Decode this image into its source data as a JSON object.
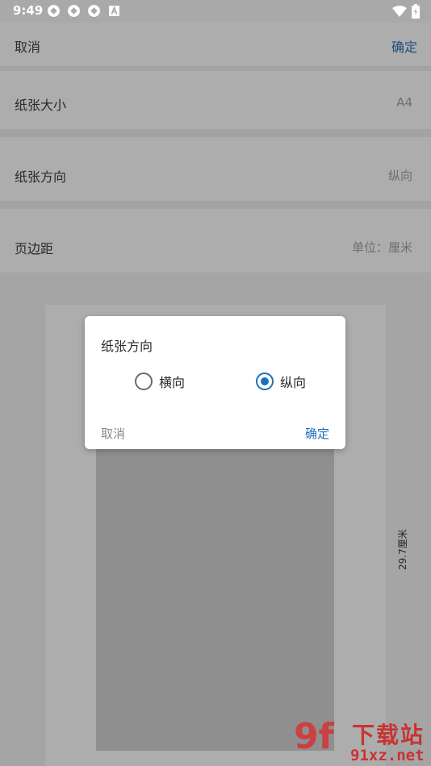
{
  "status_bar": {
    "time": "9:49",
    "icons": [
      "sync-icon",
      "sync-icon",
      "sync-icon",
      "font-a-icon"
    ],
    "right_icons": [
      "wifi-icon",
      "battery-icon"
    ]
  },
  "toolbar": {
    "cancel": "取消",
    "confirm": "确定"
  },
  "settings": {
    "paper_size": {
      "label": "纸张大小",
      "value": "A4"
    },
    "orientation": {
      "label": "纸张方向",
      "value": "纵向"
    },
    "margins": {
      "label": "页边距",
      "value": "单位：厘米"
    }
  },
  "preview": {
    "height_label": "29.7厘米"
  },
  "dialog": {
    "title": "纸张方向",
    "options": [
      {
        "label": "横向",
        "selected": false
      },
      {
        "label": "纵向",
        "selected": true
      }
    ],
    "cancel": "取消",
    "confirm": "确定",
    "accent_color": "#1e6fb8"
  },
  "watermark": {
    "logo": "9f",
    "top_text": "下载站",
    "bottom_text": "91xz.net"
  }
}
